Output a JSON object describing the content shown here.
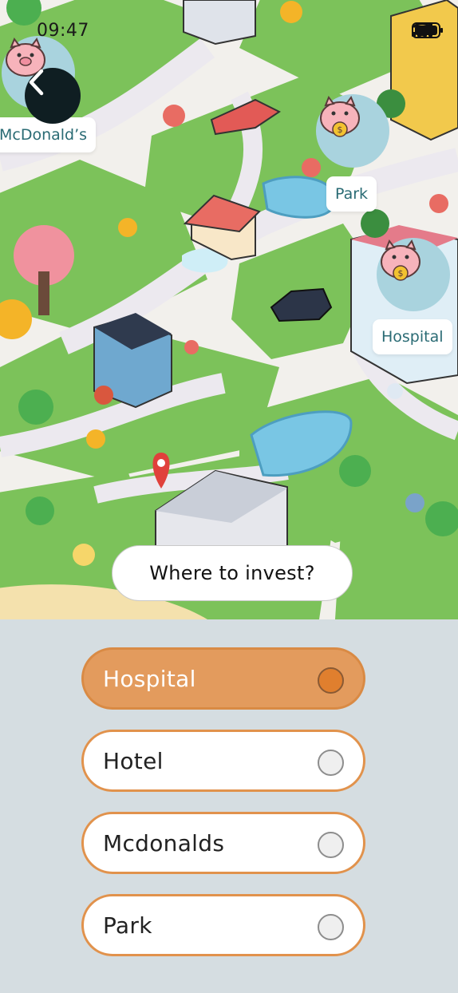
{
  "status_bar": {
    "time": "09:47",
    "icons": [
      "signal-icon",
      "wifi-icon",
      "battery-icon"
    ]
  },
  "navigation": {
    "back_icon": "chevron-left-icon"
  },
  "map": {
    "markers": [
      {
        "id": "mcdonalds",
        "label": "McDonald’s",
        "icon": "piggy-bank-icon"
      },
      {
        "id": "park",
        "label": "Park",
        "icon": "piggy-bank-icon"
      },
      {
        "id": "hospital",
        "label": "Hospital",
        "icon": "piggy-bank-icon"
      }
    ]
  },
  "question": "Where to invest?",
  "options": [
    {
      "label": "Hospital",
      "selected": true
    },
    {
      "label": "Hotel",
      "selected": false
    },
    {
      "label": "Mcdonalds",
      "selected": false
    },
    {
      "label": "Park",
      "selected": false
    }
  ],
  "colors": {
    "accent": "#e1924c",
    "selected_fill": "#e39b5d",
    "panel_bg": "#d5dde1",
    "marker_bg": "#a9d3de",
    "label_text": "#2a6b74"
  }
}
